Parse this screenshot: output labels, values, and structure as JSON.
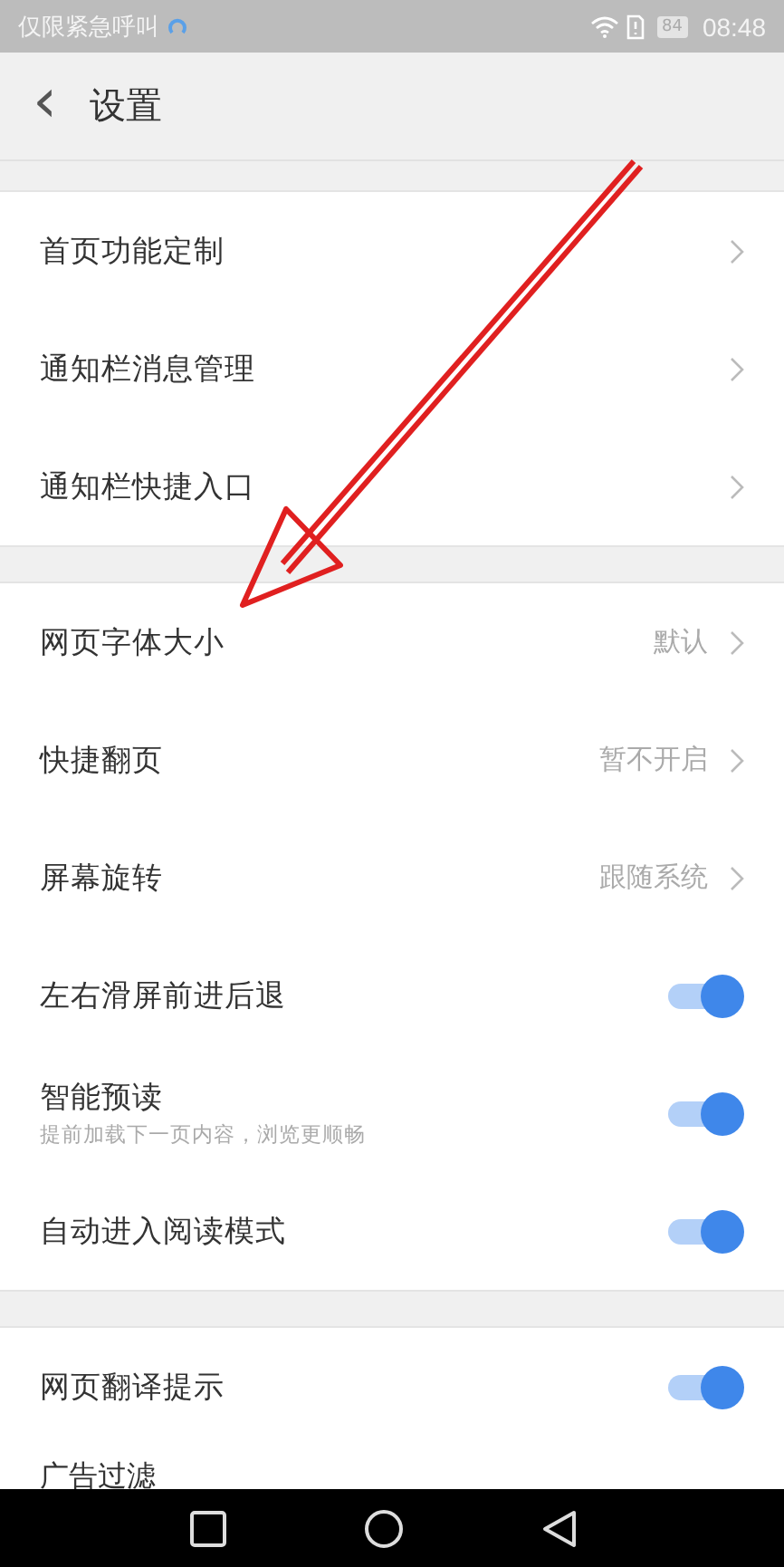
{
  "status_bar": {
    "carrier": "仅限紧急呼叫",
    "battery": "84",
    "time": "08:48"
  },
  "header": {
    "back": "‹",
    "title": "设置"
  },
  "groups": [
    {
      "items": [
        {
          "kind": "link",
          "label": "首页功能定制"
        },
        {
          "kind": "link",
          "label": "通知栏消息管理"
        },
        {
          "kind": "link",
          "label": "通知栏快捷入口"
        }
      ]
    },
    {
      "items": [
        {
          "kind": "link",
          "label": "网页字体大小",
          "value": "默认"
        },
        {
          "kind": "link",
          "label": "快捷翻页",
          "value": "暂不开启"
        },
        {
          "kind": "link",
          "label": "屏幕旋转",
          "value": "跟随系统"
        },
        {
          "kind": "toggle",
          "label": "左右滑屏前进后退",
          "on": true
        },
        {
          "kind": "toggle",
          "label": "智能预读",
          "subtitle": "提前加载下一页内容，浏览更顺畅",
          "on": true
        },
        {
          "kind": "toggle",
          "label": "自动进入阅读模式",
          "on": true
        }
      ]
    },
    {
      "items": [
        {
          "kind": "toggle",
          "label": "网页翻译提示",
          "on": true
        },
        {
          "kind": "partial",
          "label": "广告过滤"
        }
      ]
    }
  ]
}
